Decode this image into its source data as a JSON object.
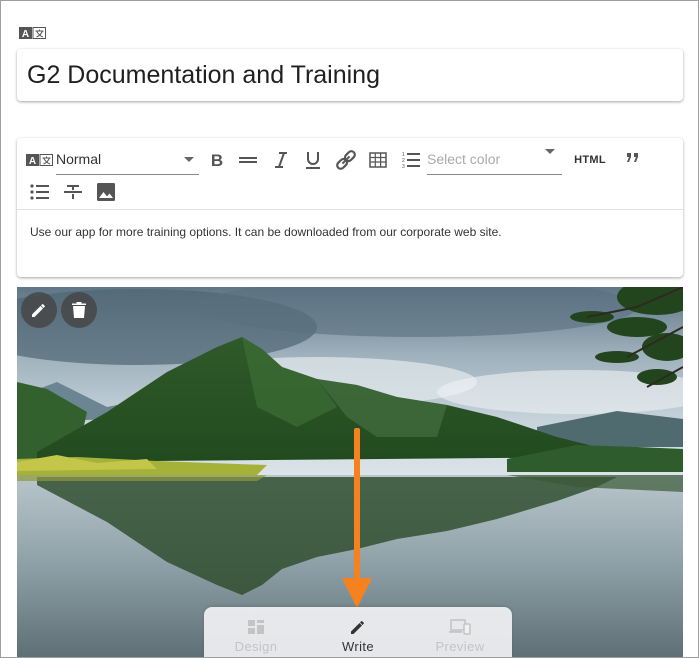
{
  "title_section": {
    "title": "G2 Documentation and Training"
  },
  "toolbar": {
    "paragraph_style": "Normal",
    "color_placeholder": "Select color",
    "html_label": "HTML"
  },
  "editor": {
    "body_text": "Use our app for more training options. It can be downloaded from our corporate web site."
  },
  "bottom_nav": {
    "items": [
      {
        "label": "Design",
        "state": "disabled"
      },
      {
        "label": "Write",
        "state": "active"
      },
      {
        "label": "Preview",
        "state": "disabled"
      }
    ]
  },
  "colors": {
    "annotation_arrow": "#f5821f",
    "icon_gray": "#555555",
    "disabled_gray": "#c4c4c4"
  }
}
